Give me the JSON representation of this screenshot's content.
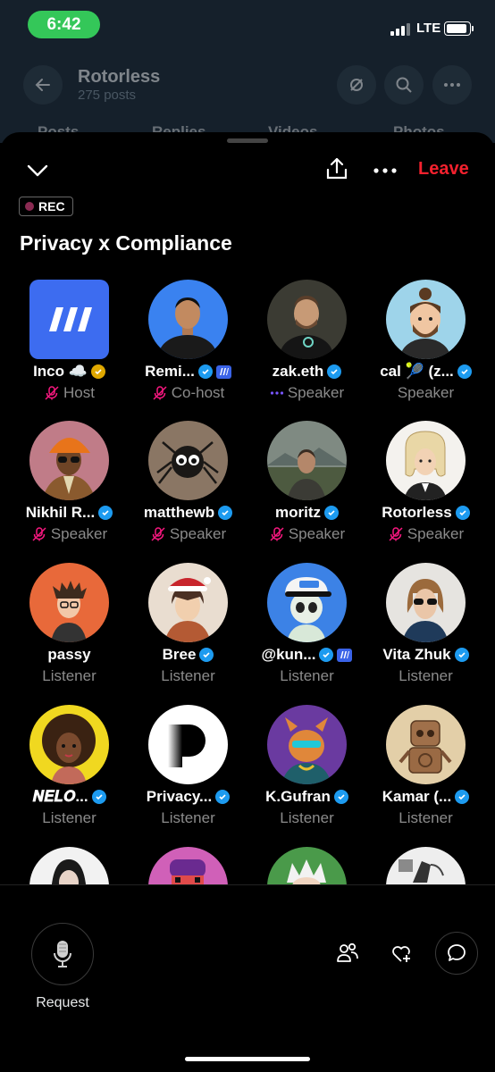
{
  "status": {
    "time": "6:42",
    "network": "LTE"
  },
  "background": {
    "title": "Rotorless",
    "subtitle": "275 posts",
    "tabs": [
      "Posts",
      "Replies",
      "Videos",
      "Photos"
    ]
  },
  "space": {
    "leave_label": "Leave",
    "rec_label": "REC",
    "title": "Privacy x Compliance",
    "participants": [
      {
        "name": "Inco ☁️",
        "role": "Host",
        "badge": "gold",
        "muted": true
      },
      {
        "name": "Remi...",
        "role": "Co-host",
        "badge": "blue",
        "affiliate": true,
        "muted": true
      },
      {
        "name": "zak.eth",
        "role": "Speaker",
        "badge": "blue",
        "speaking": true
      },
      {
        "name": "cal 🎾 (z...",
        "role": "Speaker",
        "badge": "blue"
      },
      {
        "name": "Nikhil R...",
        "role": "Speaker",
        "badge": "blue",
        "muted": true
      },
      {
        "name": "matthewb",
        "role": "Speaker",
        "badge": "blue",
        "muted": true
      },
      {
        "name": "moritz",
        "role": "Speaker",
        "badge": "blue",
        "muted": true
      },
      {
        "name": "Rotorless",
        "role": "Speaker",
        "badge": "blue",
        "muted": true
      },
      {
        "name": "passy",
        "role": "Listener"
      },
      {
        "name": "Bree",
        "role": "Listener",
        "badge": "blue"
      },
      {
        "name": "@kun...",
        "role": "Listener",
        "badge": "blue",
        "affiliate": true
      },
      {
        "name": "Vita Zhuk",
        "role": "Listener",
        "badge": "blue"
      },
      {
        "name": "𝑵𝑬𝑳𝑶...",
        "role": "Listener",
        "badge": "blue"
      },
      {
        "name": "Privacy...",
        "role": "Listener",
        "badge": "blue"
      },
      {
        "name": "K.Gufran",
        "role": "Listener",
        "badge": "blue"
      },
      {
        "name": "Kamar (...",
        "role": "Listener",
        "badge": "blue"
      }
    ]
  },
  "bottom": {
    "request_label": "Request"
  },
  "colors": {
    "accent": "#1d9bf0",
    "leave": "#f4212e",
    "muted": "#f91880",
    "time_pill": "#34c759"
  }
}
